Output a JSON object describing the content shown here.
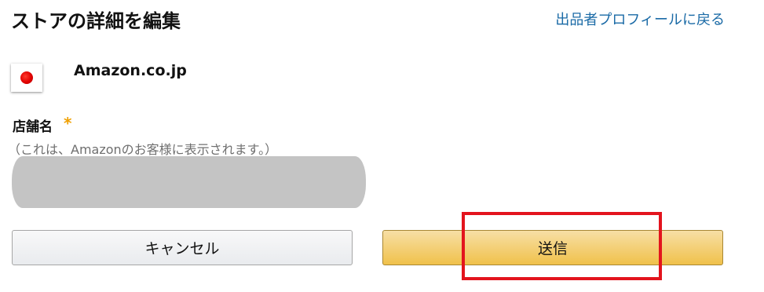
{
  "header": {
    "title": "ストアの詳細を編集",
    "back_link": "出品者プロフィールに戻る"
  },
  "marketplace": {
    "flag": "japan-flag-icon",
    "name": "Amazon.co.jp"
  },
  "form": {
    "store_name_label": "店舗名",
    "required_mark": "*",
    "store_name_hint": "（これは、Amazonのお客様に表示されます。）"
  },
  "buttons": {
    "cancel": "キャンセル",
    "submit": "送信"
  },
  "colors": {
    "link": "#1a6aa6",
    "required": "#f0a000",
    "submit_button": "#f0c14b",
    "highlight": "#e3141d"
  }
}
